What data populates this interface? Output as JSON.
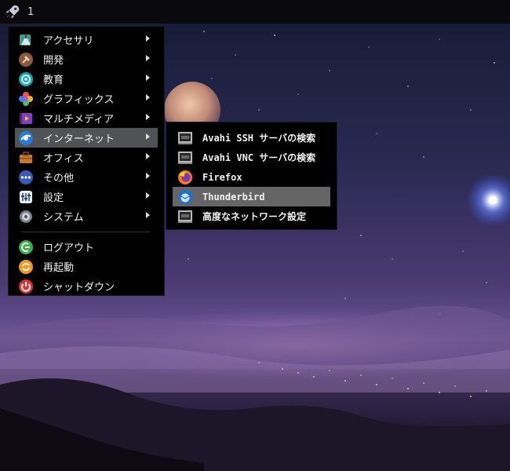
{
  "panel": {
    "workspace": "1",
    "launcher_icon": "rocket-icon"
  },
  "main_menu": {
    "items": [
      {
        "label": "アクセサリ",
        "icon": "accessories-icon",
        "submenu": true
      },
      {
        "label": "開発",
        "icon": "development-icon",
        "submenu": true
      },
      {
        "label": "教育",
        "icon": "education-icon",
        "submenu": true
      },
      {
        "label": "グラフィックス",
        "icon": "graphics-icon",
        "submenu": true
      },
      {
        "label": "マルチメディア",
        "icon": "multimedia-icon",
        "submenu": true
      },
      {
        "label": "インターネット",
        "icon": "internet-icon",
        "submenu": true,
        "active": true
      },
      {
        "label": "オフィス",
        "icon": "office-icon",
        "submenu": true
      },
      {
        "label": "その他",
        "icon": "other-icon",
        "submenu": true
      },
      {
        "label": "設定",
        "icon": "settings-icon",
        "submenu": true
      },
      {
        "label": "システム",
        "icon": "system-icon",
        "submenu": true
      }
    ],
    "session_items": [
      {
        "label": "ログアウト",
        "icon": "logout-icon"
      },
      {
        "label": "再起動",
        "icon": "reboot-icon"
      },
      {
        "label": "シャットダウン",
        "icon": "shutdown-icon"
      }
    ]
  },
  "internet_submenu": {
    "items": [
      {
        "label": "Avahi SSH サーバの検索",
        "icon": "network-server-icon"
      },
      {
        "label": "Avahi VNC サーバの検索",
        "icon": "network-server-icon"
      },
      {
        "label": "Firefox",
        "icon": "firefox-icon"
      },
      {
        "label": "Thunderbird",
        "icon": "thunderbird-icon",
        "active": true
      },
      {
        "label": "高度なネットワーク設定",
        "icon": "network-settings-icon"
      }
    ]
  },
  "colors": {
    "menu_bg": "#000000",
    "highlight_main": "#505355",
    "highlight_sub": "#656565",
    "panel_bg": "#0a0a0d"
  }
}
